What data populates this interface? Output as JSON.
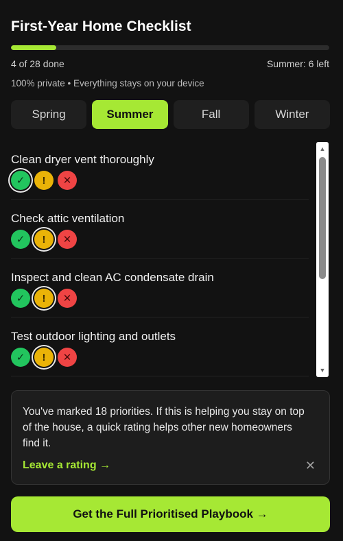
{
  "header": {
    "title": "First-Year Home Checklist",
    "progress_fraction": 0.143,
    "done_text": "4 of 28 done",
    "season_left_text": "Summer: 6 left",
    "privacy_text": "100% private • Everything stays on your device"
  },
  "tabs": [
    {
      "label": "Spring",
      "active": false
    },
    {
      "label": "Summer",
      "active": true
    },
    {
      "label": "Fall",
      "active": false
    },
    {
      "label": "Winter",
      "active": false
    }
  ],
  "tasks": [
    {
      "label": "Clean dryer vent thoroughly",
      "selected": "yes"
    },
    {
      "label": "Check attic ventilation",
      "selected": "warn"
    },
    {
      "label": "Inspect and clean AC condensate drain",
      "selected": "warn"
    },
    {
      "label": "Test outdoor lighting and outlets",
      "selected": "warn"
    }
  ],
  "rating_buttons": {
    "yes_glyph": "✓",
    "warn_glyph": "!",
    "no_glyph": "✕"
  },
  "scrollbar": {
    "up_glyph": "▲",
    "down_glyph": "▼"
  },
  "nudge": {
    "text": "You've marked 18 priorities. If this is helping you stay on top of the house, a quick rating helps other new homeowners find it.",
    "link_label": "Leave a rating →",
    "close_glyph": "✕"
  },
  "cta": {
    "label": "Get the Full Prioritised Playbook →"
  },
  "colors": {
    "accent": "#a6e834",
    "background": "#121212",
    "yes": "#22c55e",
    "warn": "#eab308",
    "no": "#ef4444"
  }
}
